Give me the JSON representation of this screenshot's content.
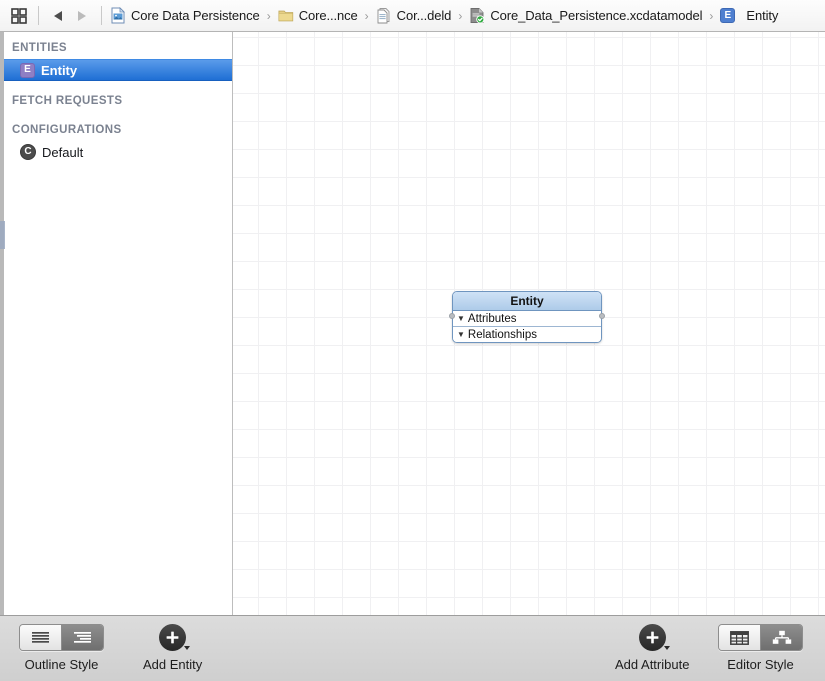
{
  "window": {
    "title": "Core_Data_Persistence.xcdatamodel — Entity"
  },
  "jumpbar": {
    "related_items_icon": "grid-icon",
    "back_label": "◀",
    "forward_label": "▶",
    "breadcrumbs": [
      {
        "label": "Core Data Persistence",
        "icon": "project-document-icon"
      },
      {
        "label": "Core...nce",
        "icon": "folder-icon"
      },
      {
        "label": "Cor...deld",
        "icon": "datamodel-group-icon"
      },
      {
        "label": "Core_Data_Persistence.xcdatamodel",
        "icon": "xcdatamodel-icon"
      },
      {
        "label": "Entity",
        "icon": "entity-badge-icon"
      }
    ],
    "separator": "›"
  },
  "sidebar": {
    "sections": [
      {
        "title": "ENTITIES",
        "items": [
          {
            "label": "Entity",
            "badge": "E",
            "badge_color": "#8f7fc4",
            "selected": true
          }
        ]
      },
      {
        "title": "FETCH REQUESTS",
        "items": []
      },
      {
        "title": "CONFIGURATIONS",
        "items": [
          {
            "label": "Default",
            "badge": "C",
            "badge_color": "#4c4c4c",
            "selected": false
          }
        ]
      }
    ]
  },
  "canvas": {
    "entity": {
      "name": "Entity",
      "rows": [
        {
          "disclosure": "▼",
          "label": "Attributes"
        },
        {
          "disclosure": "▼",
          "label": "Relationships"
        }
      ]
    }
  },
  "toolbar": {
    "outline_style": {
      "label": "Outline Style",
      "segments": [
        {
          "name": "flat-list-icon",
          "active": false
        },
        {
          "name": "hierarchical-list-icon",
          "active": true
        }
      ]
    },
    "add_entity": {
      "label": "Add Entity",
      "icon": "plus-circle-icon"
    },
    "add_attribute": {
      "label": "Add Attribute",
      "icon": "plus-circle-icon"
    },
    "editor_style": {
      "label": "Editor Style",
      "segments": [
        {
          "name": "table-grid-icon",
          "active": false
        },
        {
          "name": "graph-hierarchy-icon",
          "active": true
        }
      ]
    }
  },
  "colors": {
    "selection_blue": "#1f6fd4",
    "entity_header_blue": "#aecbe9",
    "entity_border": "#6f95bf",
    "toolbar_gray": "#d4d4d4",
    "badge_purple": "#8f7fc4"
  }
}
